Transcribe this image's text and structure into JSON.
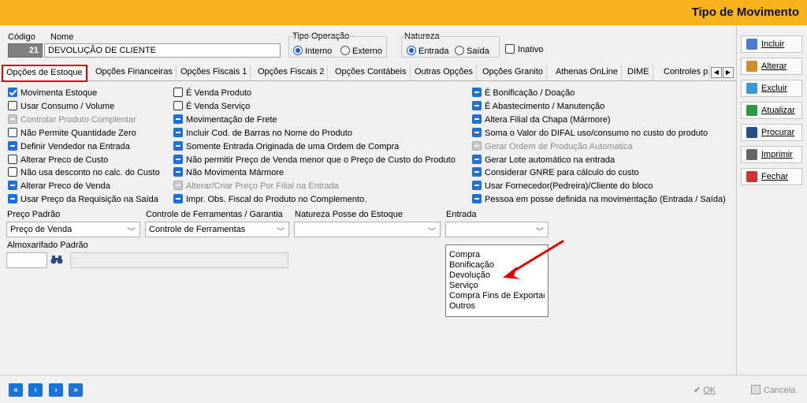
{
  "window": {
    "title": "Tipo de Movimento"
  },
  "header": {
    "codigo_label": "Código",
    "codigo_value": "21",
    "nome_label": "Nome",
    "nome_value": "DEVOLUÇÃO DE CLIENTE",
    "tipo_operacao_label": "Tipo Operação",
    "tipo_operacao_options": [
      "Interno",
      "Externo"
    ],
    "tipo_operacao_selected": "Interno",
    "natureza_label": "Natureza",
    "natureza_options": [
      "Entrada",
      "Saída"
    ],
    "natureza_selected": "Entrada",
    "inativo_label": "Inativo"
  },
  "tabs": [
    "Opções de Estoque",
    "Opções Financeiras",
    "Opções Fiscais 1",
    "Opções Fiscais 2",
    "Opções Contábeis",
    "Outras Opções",
    "Opções Granito",
    "Athenas OnLine",
    "DIME",
    "Controles p"
  ],
  "active_tab": "Opções de Estoque",
  "options_col1": [
    {
      "label": "Movimenta Estoque",
      "state": "checked"
    },
    {
      "label": "Usar Consumo / Volume",
      "state": "unchecked"
    },
    {
      "label": "Controlar Produto Complentar",
      "state": "disabled"
    },
    {
      "label": "Não Permite Quantidade Zero",
      "state": "unchecked"
    },
    {
      "label": "Definir Vendedor na Entrada",
      "state": "indeterminate"
    },
    {
      "label": "Alterar Preco de Custo",
      "state": "unchecked"
    },
    {
      "label": "Não usa desconto no calc. do Custo",
      "state": "unchecked"
    },
    {
      "label": "Alterar Preco de Venda",
      "state": "indeterminate"
    },
    {
      "label": "Usar Preço da Requisição na Saída",
      "state": "indeterminate"
    }
  ],
  "options_col2": [
    {
      "label": "É Venda Produto",
      "state": "unchecked"
    },
    {
      "label": "É Venda Serviço",
      "state": "unchecked"
    },
    {
      "label": "Movimentação de Frete",
      "state": "indeterminate"
    },
    {
      "label": "Incluir Cod. de Barras no Nome do Produto",
      "state": "indeterminate"
    },
    {
      "label": "Somente Entrada Originada de uma Ordem de Compra",
      "state": "indeterminate"
    },
    {
      "label": "Não permitir Preço de Venda menor que o Preço de Custo do Produto",
      "state": "indeterminate"
    },
    {
      "label": "Não Movimenta Mármore",
      "state": "indeterminate"
    },
    {
      "label": "Alterar/Criar Preço Por Filial na Entrada",
      "state": "disabled"
    },
    {
      "label": "Impr. Obs. Fiscal do Produto no Complemento.",
      "state": "indeterminate"
    }
  ],
  "options_col3": [
    {
      "label": "É Bonificação / Doação",
      "state": "indeterminate"
    },
    {
      "label": "É Abastecimento / Manutenção",
      "state": "indeterminate"
    },
    {
      "label": "Altera Filial da Chapa (Mármore)",
      "state": "indeterminate"
    },
    {
      "label": "Soma o Valor do DIFAL uso/consumo no custo do produto",
      "state": "indeterminate"
    },
    {
      "label": "Gerar Ordem de Produção Automatica",
      "state": "disabled"
    },
    {
      "label": "Gerar Lote automático na entrada",
      "state": "indeterminate"
    },
    {
      "label": "Considerar GNRE para cálculo do custo",
      "state": "indeterminate"
    },
    {
      "label": "Usar Fornecedor(Pedreira)/Cliente do bloco",
      "state": "indeterminate"
    },
    {
      "label": "Pessoa em posse definida na movimentação (Entrada / Saída)",
      "state": "indeterminate"
    }
  ],
  "fields": {
    "preco_padrao_label": "Preço Padrão",
    "preco_padrao_value": "Preço de Venda",
    "controle_ferramentas_label": "Controle de Ferramentas / Garantia",
    "controle_ferramentas_value": "Controle de Ferramentas",
    "natureza_posse_label": "Natureza Posse do Estoque",
    "natureza_posse_value": "",
    "entrada_label": "Entrada",
    "entrada_value": "",
    "almoxarifado_label": "Almoxarifado Padrão"
  },
  "entrada_dropdown": [
    "Compra",
    "Bonificação",
    "Devolução",
    "Serviço",
    "Compra Fins de Exportaç",
    "Outros"
  ],
  "sidebar": [
    {
      "label": "Incluir",
      "icon": "document-icon",
      "color": "#4a7bd0"
    },
    {
      "label": "Alterar",
      "icon": "edit-icon",
      "color": "#d08a2a"
    },
    {
      "label": "Excluir",
      "icon": "delete-icon",
      "color": "#3a9ad9"
    },
    {
      "label": "Atualizar",
      "icon": "refresh-icon",
      "color": "#2e9a3e"
    },
    {
      "label": "Procurar",
      "icon": "binoculars-icon",
      "color": "#2a4e8a"
    },
    {
      "label": "Imprimir",
      "icon": "printer-icon",
      "color": "#666666"
    },
    {
      "label": "Fechar",
      "icon": "close-door-icon",
      "color": "#d03030"
    }
  ],
  "bottom": {
    "nav": [
      "«",
      "‹",
      "›",
      "»"
    ],
    "ok_label": "OK",
    "cancel_label": "Cancela"
  },
  "colors": {
    "titlebar": "#f7b21e",
    "accent": "#1e6fd9",
    "highlight": "#e00000"
  }
}
